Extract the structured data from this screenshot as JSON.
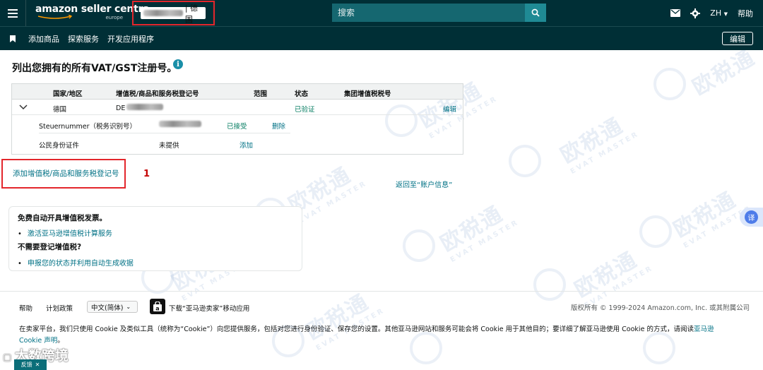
{
  "header": {
    "logo_text": "amazon seller centra",
    "logo_sub": "europe",
    "store_label": "| 德国",
    "search_placeholder": "搜索",
    "language": "ZH",
    "help": "帮助"
  },
  "subnav": {
    "items": [
      "添加商品",
      "探索服务",
      "开发应用程序"
    ],
    "edit_label": "编辑"
  },
  "page": {
    "heading": "列出您拥有的所有VAT/GST注册号。",
    "info_icon": "i"
  },
  "table": {
    "columns": [
      "国家/地区",
      "增值税/商品和服务税登记号",
      "范围",
      "状态",
      "集团增值税税号"
    ],
    "row": {
      "country": "德国",
      "vat_number_prefix": "DE",
      "status": "已验证",
      "action": "编辑"
    },
    "subrows": [
      {
        "label": "Steuernummer（税务识别号）",
        "value": "",
        "status": "已接受",
        "action": "删除"
      },
      {
        "label": "公民身份证件",
        "value": "未提供",
        "status": "",
        "action": "添加"
      }
    ]
  },
  "actions": {
    "add_vat": "添加增值税/商品和服务税登记号",
    "annotation_number": "1",
    "back_link": "返回至“账户信息”"
  },
  "promo_card": {
    "title1": "免费自动开具增值税发票。",
    "link1": "激活亚马逊增值税计算服务",
    "title2": "不需要登记增值税?",
    "link2": "申报您的状态并利用自动生成收据"
  },
  "footer": {
    "help": "帮助",
    "program_policy": "计划政策",
    "language_select": "中文(简体)",
    "app_download": "下载“亚马逊卖家”移动应用",
    "copyright": "版权所有 © 1999-2024 Amazon.com, Inc. 或其附属公司",
    "cookie_text": "在卖家平台，我们只使用 Cookie 及类似工具（统称为“Cookie”）向您提供服务，包括对您进行身份验证、保存您的设置。其他亚马逊网站和服务可能会将 Cookie 用于其他目的；要详细了解亚马逊使用 Cookie 的方式，请阅读",
    "cookie_link": "亚马逊 Cookie 声明",
    "cookie_end": "。"
  },
  "overlay": {
    "translate_label": "译",
    "watermark_big": "欧税通",
    "watermark_small": "EVAT MASTER",
    "corner_brand": "大数跨境",
    "feedback": "反馈"
  },
  "colors": {
    "header_bg": "#002f36",
    "search_bg": "#156770",
    "link": "#007185",
    "verified_green": "#067d62",
    "annotation_red": "#e3262c"
  }
}
